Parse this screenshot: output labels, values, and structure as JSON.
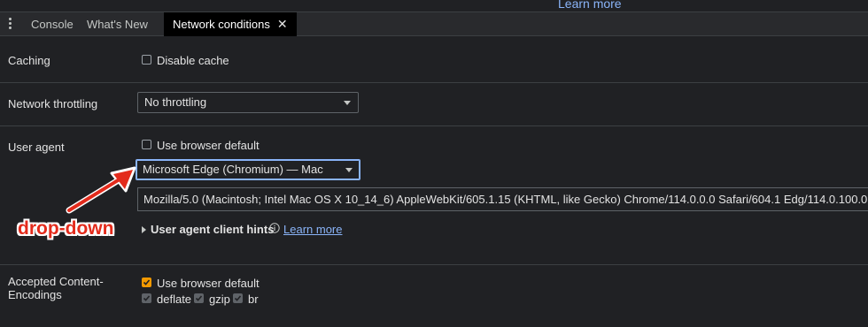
{
  "top_link": "Learn more",
  "tabs": [
    {
      "label": "Console"
    },
    {
      "label": "What's New"
    },
    {
      "label": "Network conditions",
      "active": true,
      "close": "✕"
    }
  ],
  "caching": {
    "label": "Caching",
    "disable_cache": {
      "label": "Disable cache",
      "checked": false
    }
  },
  "throttling": {
    "label": "Network throttling",
    "selected": "No throttling"
  },
  "user_agent": {
    "label": "User agent",
    "use_default": {
      "label": "Use browser default",
      "checked": false
    },
    "selected": "Microsoft Edge (Chromium) — Mac",
    "ua_string": "Mozilla/5.0 (Macintosh; Intel Mac OS X 10_14_6) AppleWebKit/605.1.15 (KHTML, like Gecko) Chrome/114.0.0.0 Safari/604.1 Edg/114.0.100.0",
    "client_hints": {
      "label": "User agent client hints",
      "link": "Learn more"
    }
  },
  "encodings": {
    "label_line1": "Accepted Content-",
    "label_line2": "Encodings",
    "use_default": {
      "label": "Use browser default",
      "checked": true
    },
    "options": [
      {
        "label": "deflate",
        "checked": true
      },
      {
        "label": "gzip",
        "checked": true
      },
      {
        "label": "br",
        "checked": true
      }
    ]
  },
  "annotation": "drop-down",
  "colors": {
    "background": "#202124",
    "accent_link": "#8ab4f8",
    "checkbox_checked": "#f29900",
    "annotation_red": "#e32b1c"
  }
}
